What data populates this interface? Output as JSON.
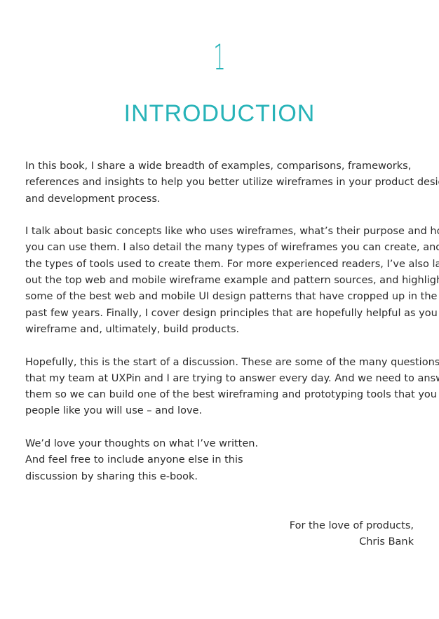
{
  "chapter": {
    "number": "1",
    "title": "INTRODUCTION"
  },
  "paragraphs": [
    {
      "lines": [
        "In this book, I share a wide breadth of examples, comparisons, frameworks,",
        "references and insights to help you better utilize wireframes in your product design",
        "and development process."
      ]
    },
    {
      "lines": [
        "I talk about basic concepts like who uses wireframes, what’s their purpose and how",
        "you can use them. I also detail the many types of wireframes you can create, and",
        "the types of tools used to create them. For more experienced readers, I’ve also laid",
        "out the top web and mobile wireframe example and pattern sources, and highlight",
        "some of the best web and mobile UI design patterns that have cropped up in the",
        "past few years. Finally, I cover design principles that are hopefully helpful as you",
        "wireframe and, ultimately, build products."
      ]
    },
    {
      "lines": [
        "Hopefully, this is the start of a discussion. These are some of the many questions",
        "that my team at UXPin and I are trying to answer every day. And we need to answer",
        "them so we can build one of the best wireframing and prototyping tools that you or",
        "people like you will use – and love."
      ]
    },
    {
      "lines": [
        "We’d love your thoughts on what I’ve written.",
        "And feel free to include anyone else in this",
        "discussion by sharing this e-book."
      ]
    }
  ],
  "signoff": {
    "line1": "For the love of products,",
    "line2": "Chris Bank"
  }
}
